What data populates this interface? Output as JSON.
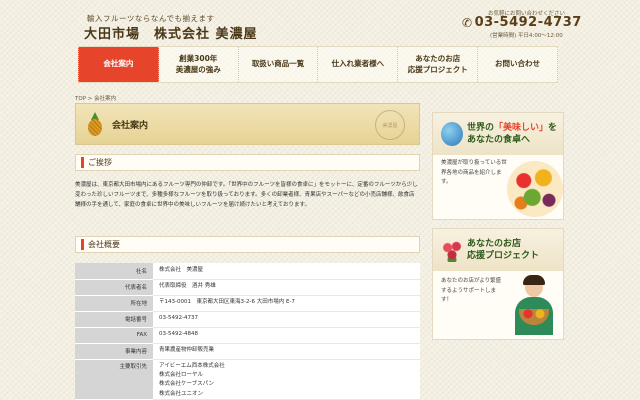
{
  "header": {
    "tagline": "輸入フルーツならなんでも揃えます",
    "title": "大田市場　株式会社 美濃屋",
    "contact_note": "お気軽にお問い合わせください",
    "phone": "03-5492-4737",
    "hours": "(営業時間) 平日4:00〜12:00"
  },
  "nav": [
    {
      "label": "会社案内",
      "active": true
    },
    {
      "label": "創業300年\n美濃屋の強み"
    },
    {
      "label": "取扱い商品一覧"
    },
    {
      "label": "仕入れ業者様へ"
    },
    {
      "label": "あなたのお店\n応援プロジェクト"
    },
    {
      "label": "お問い合わせ"
    }
  ],
  "breadcrumb": "TOP > 会社案内",
  "banner": {
    "title": "会社案内",
    "stamp": "美濃屋"
  },
  "greeting": {
    "heading": "ご挨拶",
    "text": "美濃屋は、東京都大田市場内にあるフルーツ専門の仲卸です。「世界中のフルーツを皆様の食卓に」をモットーに、定番のフルーツから少し変わった珍しいフルーツまで、多種多様なフルーツを取り扱っております。多くの卸業者様、青果店やスーパーなどの小売店舗様、飲食店舗様の手を通して、家庭の食卓に世界中の美味しいフルーツを届け続けたいと考えております。"
  },
  "overview": {
    "heading": "会社概要",
    "rows": [
      {
        "label": "社名",
        "value": "株式会社　美濃屋"
      },
      {
        "label": "代表者名",
        "value": "代表取締役　酒井 秀雄"
      },
      {
        "label": "所在地",
        "value": "〒143-0001　東京都大田区東海3-2-6 大田市場内 E-7"
      },
      {
        "label": "電話番号",
        "value": "03-5492-4737"
      },
      {
        "label": "FAX",
        "value": "03-5492-4848"
      },
      {
        "label": "事業内容",
        "value": "青果農産物仲卸販売業"
      },
      {
        "label": "主要取引先",
        "value": "アイビーエム西本株式会社\n株式会社ローヤル\n株式会社ケーブスパン\n株式会社ユニオン"
      }
    ]
  },
  "sidebar": {
    "world": {
      "heading_pre": "世界の",
      "heading_hl": "「美味しい」",
      "heading_post": "を\nあなたの食卓へ",
      "text": "美濃屋が取り扱っている世界各地の商品を紹介します。"
    },
    "support": {
      "heading": "あなたのお店\n応援プロジェクト",
      "text": "あなたのお店がより繁盛するようサポートします！"
    }
  },
  "colors": {
    "accent": "#e7442c",
    "brand_green": "#2d5a1a",
    "banner": "#ead9a0"
  }
}
